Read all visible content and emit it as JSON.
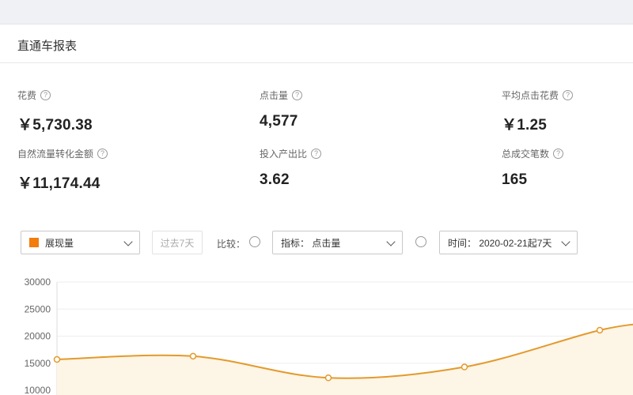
{
  "panel": {
    "title": "直通车报表"
  },
  "metrics": [
    {
      "label": "花费",
      "value": "￥5,730.38"
    },
    {
      "label": "点击量",
      "value": "4,577"
    },
    {
      "label": "平均点击花费",
      "value": "￥1.25"
    },
    {
      "label": "自然流量转化金额",
      "value": "￥11,174.44"
    },
    {
      "label": "投入产出比",
      "value": "3.62"
    },
    {
      "label": "总成交笔数",
      "value": "165"
    }
  ],
  "controls": {
    "series_select": {
      "value": "展现量",
      "color": "#f27c0c"
    },
    "period_button": "过去7天",
    "compare_label": "比较：",
    "indicator_select": {
      "value": "指标： 点击量"
    },
    "time_select": {
      "value": "时间： 2020-02-21起7天"
    }
  },
  "icons": {
    "help": "?",
    "help_icon": "question-circle-icon",
    "dropdown_icon": "chevron-down-icon"
  },
  "chart_data": {
    "type": "line",
    "series": [
      {
        "values": [
          15700,
          16300,
          12300,
          14300,
          21100,
          22500
        ],
        "color": "#e39a2c"
      }
    ],
    "x_index": [
      0,
      1,
      2,
      3,
      4,
      5
    ],
    "y_ticks": [
      10000,
      15000,
      20000,
      25000,
      30000
    ],
    "y_tick_labels": [
      "10000",
      "15000",
      "20000",
      "25000",
      "30000"
    ],
    "ylim": [
      10000,
      30000
    ],
    "grid": true
  }
}
